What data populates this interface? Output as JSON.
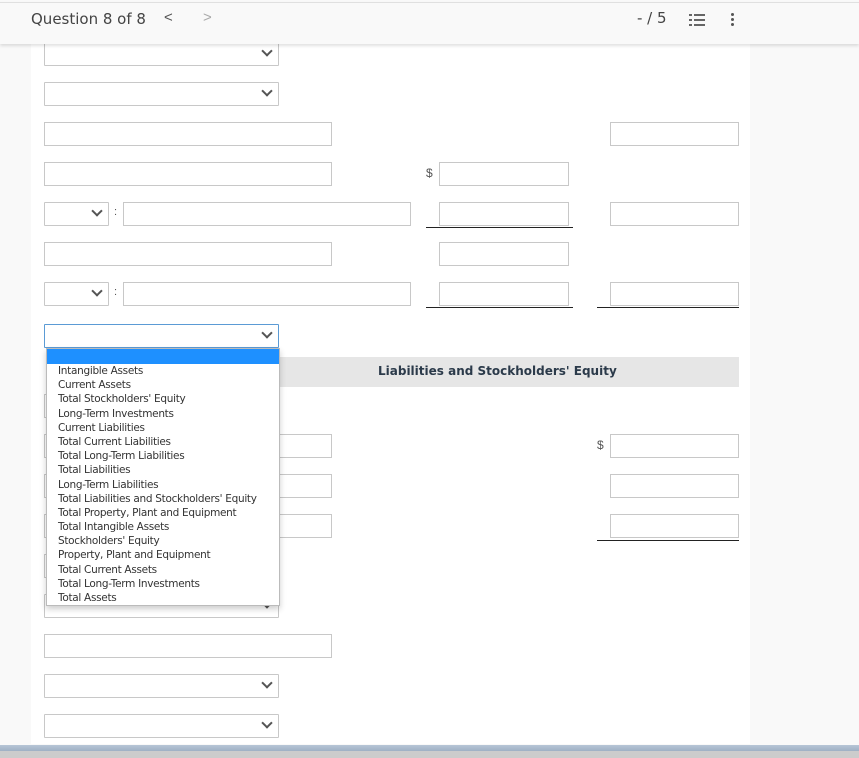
{
  "header": {
    "question_label": "Question 8 of 8",
    "prev_glyph": "<",
    "next_glyph": ">",
    "score": "- / 5"
  },
  "form": {
    "currency_symbol": "$",
    "colon": ":",
    "section_title": "Liabilities and Stockholders' Equity"
  },
  "dropdown": {
    "selected": "",
    "options": [
      "",
      "Intangible Assets",
      "Current Assets",
      "Total Stockholders' Equity",
      "Long-Term Investments",
      "Current Liabilities",
      "Total Current Liabilities",
      "Total Long-Term Liabilities",
      "Total Liabilities",
      "Long-Term Liabilities",
      "Total Liabilities and Stockholders' Equity",
      "Total Property, Plant and Equipment",
      "Total Intangible Assets",
      "Stockholders' Equity",
      "Property, Plant and Equipment",
      "Total Current Assets",
      "Total Long-Term Investments",
      "Total Assets"
    ]
  }
}
